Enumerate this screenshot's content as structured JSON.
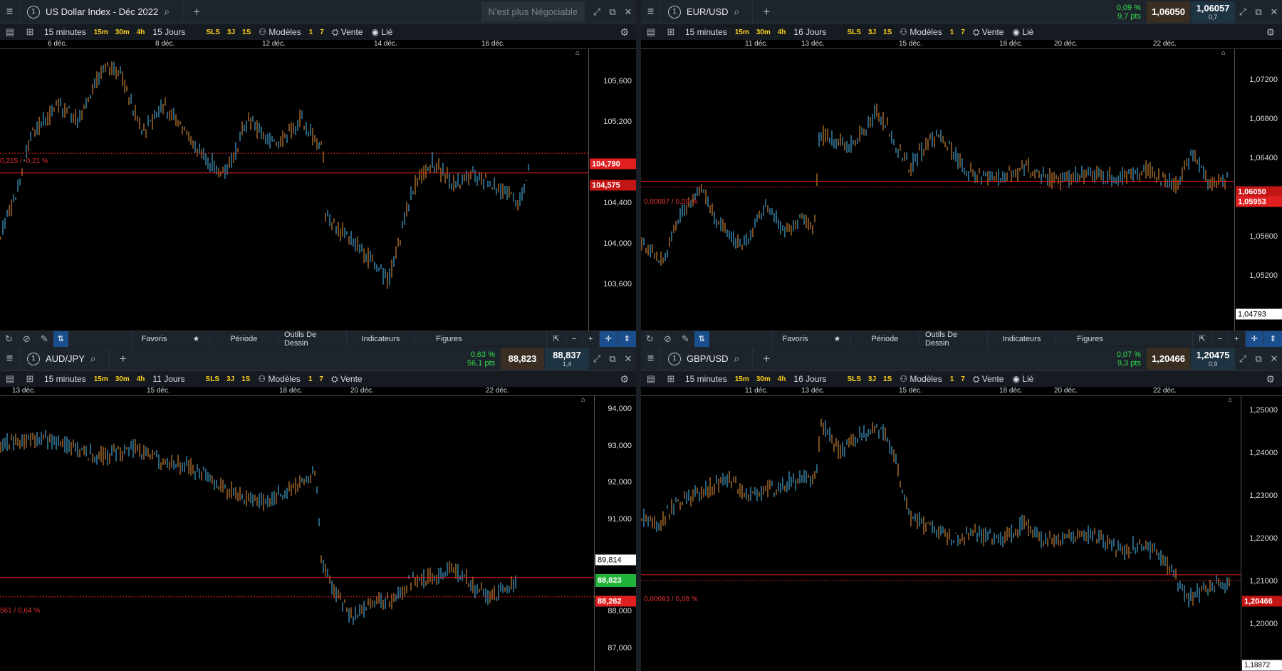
{
  "panels": [
    {
      "id": "usd",
      "number": "1",
      "name": "US Dollar Index - Déc 2022",
      "status": "N'est plus Négociable",
      "interval": "15 minutes",
      "period": "15 Jours",
      "models": "Modèles",
      "sell_label": "Vente",
      "linked": "Lié",
      "dates": [
        "6 déc.",
        "8 déc.",
        "12 déc.",
        "14 déc.",
        "16 déc."
      ],
      "ticks": [
        "105,600",
        "105,200",
        "104,400",
        "104,000",
        "103,600"
      ],
      "price_tag": "104,575",
      "prev_tag": "104,790",
      "change_label": "0,215 / -0,21 %"
    },
    {
      "id": "eur",
      "number": "1",
      "name": "EUR/USD",
      "change_pct": "0,09 %",
      "change_pts": "9,7 pts",
      "sell": "1,06050",
      "buy": "1,06057",
      "spread": "0,7",
      "interval": "15 minutes",
      "period": "16 Jours",
      "models": "Modèles",
      "sell_label": "Vente",
      "linked": "Lié",
      "dates": [
        "11 déc.",
        "13 déc.",
        "15 déc.",
        "18 déc.",
        "20 déc.",
        "22 déc."
      ],
      "ticks": [
        "1,07200",
        "1,06800",
        "1,06400",
        "1,05600",
        "1,05200"
      ],
      "price_tag": "1,06050",
      "prev_tag": "1,05953",
      "low_tag": "1,04793",
      "change_label": "0,00097 / 0,09 %"
    },
    {
      "id": "aud",
      "number": "1",
      "name": "AUD/JPY",
      "change_pct": "0,63 %",
      "change_pts": "56,1 pts",
      "sell": "88,823",
      "buy": "88,837",
      "spread": "1,4",
      "interval": "15 minutes",
      "period": "11 Jours",
      "models": "Modèles",
      "sell_label": "Vente",
      "dates": [
        "13 déc.",
        "15 déc.",
        "18 déc.",
        "20 déc.",
        "22 déc."
      ],
      "ticks": [
        "94,000",
        "93,000",
        "92,000",
        "91,000",
        "88,000",
        "87,000"
      ],
      "price_tag": "88,823",
      "prev_tag": "88,262",
      "high_tag": "89,814",
      "change_label": "561 / 0,64 %"
    },
    {
      "id": "gbp",
      "number": "1",
      "name": "GBP/USD",
      "change_pct": "0,07 %",
      "change_pts": "9,3 pts",
      "sell": "1,20466",
      "buy": "1,20475",
      "spread": "0,9",
      "interval": "15 minutes",
      "period": "16 Jours",
      "models": "Modèles",
      "sell_label": "Vente",
      "linked": "Lié",
      "dates": [
        "11 déc.",
        "13 déc.",
        "15 déc.",
        "18 déc.",
        "20 déc.",
        "22 déc."
      ],
      "ticks": [
        "1,25000",
        "1,24000",
        "1,23000",
        "1,22000",
        "1,21000",
        "1,20000"
      ],
      "price_tag": "1,20466",
      "low_tag": "1,18872",
      "change_label": "0,00093 / 0,08 %"
    }
  ],
  "timeframes": [
    "15m",
    "30m",
    "4h"
  ],
  "quick": [
    "SLS",
    "3J",
    "1S"
  ],
  "counts": [
    "1",
    "7"
  ],
  "bottombar": {
    "favorites": "Favoris",
    "period": "Période",
    "draw": "Outils De Dessin",
    "indicators": "Indicateurs",
    "figures": "Figures"
  },
  "colors": {
    "up": "#4fc3f7",
    "down": "#f09a3e",
    "price_line": "#e02020",
    "positive": "#2fdc4a",
    "sell_bg": "#3a2e22",
    "buy_bg": "#1f3442"
  },
  "icons": [
    "menu-icon",
    "search-icon",
    "plus-icon",
    "expand-icon",
    "popout-icon",
    "close-icon",
    "gear-icon",
    "refresh-icon",
    "pencil-icon",
    "star-icon",
    "zoom-out-icon",
    "zoom-in-icon",
    "crosshair-icon",
    "home-icon"
  ]
}
